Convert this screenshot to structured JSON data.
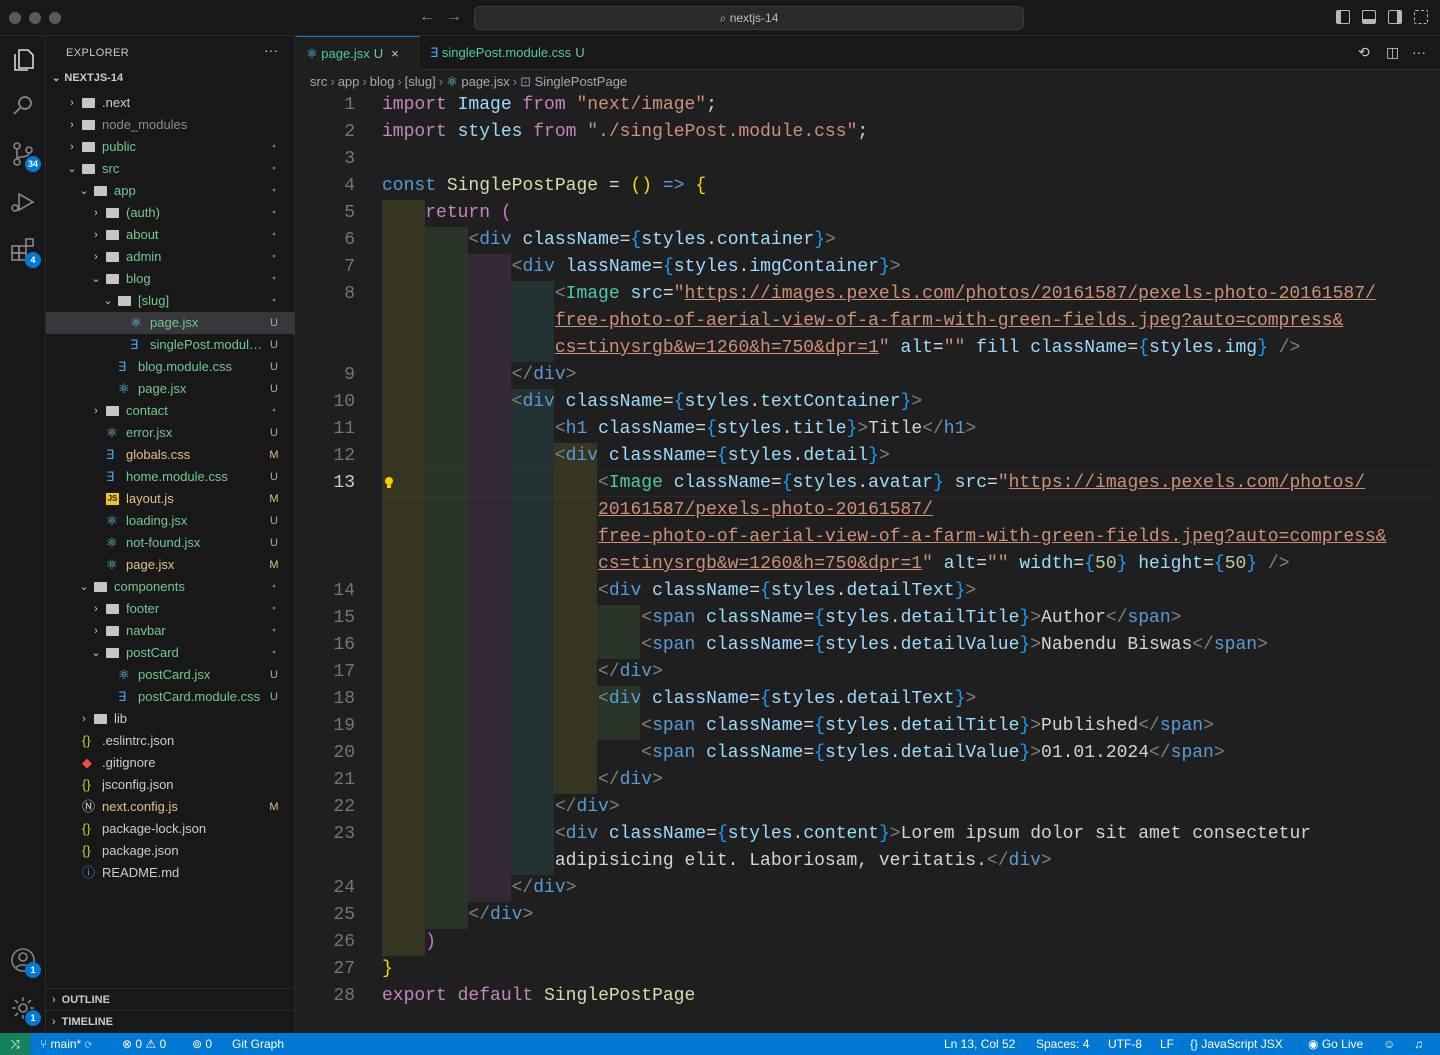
{
  "titlebar": {
    "search_text": "nextjs-14"
  },
  "activity": {
    "source_control_badge": "34",
    "extensions_badge": "4",
    "accounts_badge": "1",
    "manage_badge": "1"
  },
  "explorer": {
    "title": "EXPLORER",
    "more": "···",
    "project": "NEXTJS-14",
    "outline": "OUTLINE",
    "timeline": "TIMELINE"
  },
  "tree": [
    {
      "label": ".next",
      "status": "",
      "color": "#cccccc"
    },
    {
      "label": "node_modules",
      "status": "",
      "color": "#8c8c8c"
    },
    {
      "label": "public",
      "status": "●",
      "color": "#73c991"
    },
    {
      "label": "src",
      "status": "●",
      "color": "#73c991"
    },
    {
      "label": "app",
      "status": "●",
      "color": "#73c991"
    },
    {
      "label": "(auth)",
      "status": "●",
      "color": "#73c991"
    },
    {
      "label": "about",
      "status": "●",
      "color": "#73c991"
    },
    {
      "label": "admin",
      "status": "●",
      "color": "#73c991"
    },
    {
      "label": "blog",
      "status": "●",
      "color": "#73c991"
    },
    {
      "label": "[slug]",
      "status": "●",
      "color": "#73c991"
    },
    {
      "label": "page.jsx",
      "status": "U",
      "color": "#73c991"
    },
    {
      "label": "singlePost.module....",
      "status": "U",
      "color": "#73c991"
    },
    {
      "label": "blog.module.css",
      "status": "U",
      "color": "#73c991"
    },
    {
      "label": "page.jsx",
      "status": "U",
      "color": "#73c991"
    },
    {
      "label": "contact",
      "status": "●",
      "color": "#73c991"
    },
    {
      "label": "error.jsx",
      "status": "U",
      "color": "#73c991"
    },
    {
      "label": "globals.css",
      "status": "M",
      "color": "#e2c08d"
    },
    {
      "label": "home.module.css",
      "status": "U",
      "color": "#73c991"
    },
    {
      "label": "layout.js",
      "status": "M",
      "color": "#e2c08d"
    },
    {
      "label": "loading.jsx",
      "status": "U",
      "color": "#73c991"
    },
    {
      "label": "not-found.jsx",
      "status": "U",
      "color": "#73c991"
    },
    {
      "label": "page.jsx",
      "status": "M",
      "color": "#e2c08d"
    },
    {
      "label": "components",
      "status": "●",
      "color": "#73c991"
    },
    {
      "label": "footer",
      "status": "●",
      "color": "#73c991"
    },
    {
      "label": "navbar",
      "status": "●",
      "color": "#73c991"
    },
    {
      "label": "postCard",
      "status": "●",
      "color": "#73c991"
    },
    {
      "label": "postCard.jsx",
      "status": "U",
      "color": "#73c991"
    },
    {
      "label": "postCard.module.css",
      "status": "U",
      "color": "#73c991"
    },
    {
      "label": "lib",
      "status": "",
      "color": "#cccccc"
    },
    {
      "label": ".eslintrc.json",
      "status": "",
      "color": "#cccccc"
    },
    {
      "label": ".gitignore",
      "status": "",
      "color": "#cccccc"
    },
    {
      "label": "jsconfig.json",
      "status": "",
      "color": "#cccccc"
    },
    {
      "label": "next.config.js",
      "status": "M",
      "color": "#e2c08d"
    },
    {
      "label": "package-lock.json",
      "status": "",
      "color": "#cccccc"
    },
    {
      "label": "package.json",
      "status": "",
      "color": "#cccccc"
    },
    {
      "label": "README.md",
      "status": "",
      "color": "#cccccc"
    }
  ],
  "tabs": [
    {
      "label": "page.jsx",
      "status": "U",
      "close": "×"
    },
    {
      "label": "singlePost.module.css",
      "status": "U"
    }
  ],
  "breadcrumb": [
    "src",
    "app",
    "blog",
    "[slug]",
    "page.jsx",
    "SinglePostPage"
  ],
  "editor": {
    "line_numbers": [
      "1",
      "2",
      "3",
      "4",
      "5",
      "6",
      "7",
      "8",
      "9",
      "10",
      "11",
      "12",
      "13",
      "14",
      "15",
      "16",
      "17",
      "18",
      "19",
      "20",
      "21",
      "22",
      "23",
      "24",
      "25",
      "26",
      "27",
      "28"
    ],
    "current_line": "13"
  },
  "statusbar": {
    "branch": "main*",
    "errors": "0",
    "warnings": "0",
    "ports": "0",
    "git_graph": "Git Graph",
    "cursor": "Ln 13, Col 52",
    "spaces": "Spaces: 4",
    "encoding": "UTF-8",
    "eol": "LF",
    "language": "JavaScript JSX",
    "go_live": "Go Live"
  },
  "colors": {
    "accent": "#0078d4",
    "untracked": "#73c991",
    "modified": "#e2c08d",
    "remote": "#16825d"
  }
}
